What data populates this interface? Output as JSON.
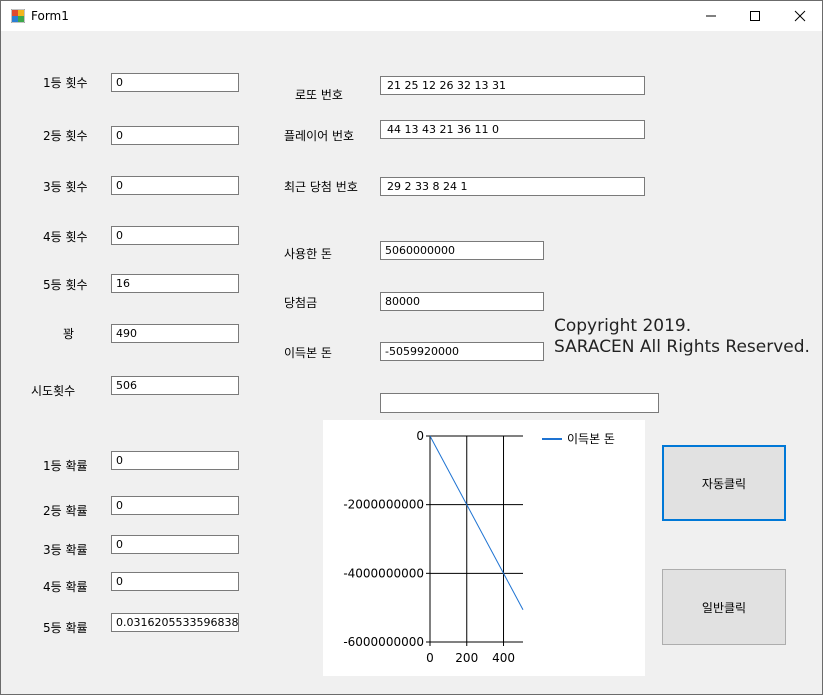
{
  "window": {
    "title": "Form1"
  },
  "left": [
    {
      "label": "1등 횟수",
      "value": "0"
    },
    {
      "label": "2등 횟수",
      "value": "0"
    },
    {
      "label": "3등 횟수",
      "value": "0"
    },
    {
      "label": "4등 횟수",
      "value": "0"
    },
    {
      "label": "5등 횟수",
      "value": "16"
    },
    {
      "label": "꽝",
      "value": "490"
    },
    {
      "label": "시도횟수",
      "value": "506"
    },
    {
      "label": "1등 확률",
      "value": "0"
    },
    {
      "label": "2등 확률",
      "value": "0"
    },
    {
      "label": "3등 확률",
      "value": "0"
    },
    {
      "label": "4등 확률",
      "value": "0"
    },
    {
      "label": "5등 확률",
      "value": "0.0316205533596838"
    }
  ],
  "mid": [
    {
      "label": "로또 번호",
      "value": "21 25 12 26 32 13 31"
    },
    {
      "label": "플레이어 번호",
      "value": "44 13 43 21 36 11 0"
    },
    {
      "label": "최근 당첨 번호",
      "value": "29 2 33 8 24 1"
    },
    {
      "label": "사용한 돈",
      "value": "5060000000"
    },
    {
      "label": "당첨금",
      "value": "80000"
    },
    {
      "label": "이득본 돈",
      "value": "-5059920000"
    }
  ],
  "extra_textbox": {
    "value": ""
  },
  "copyright": {
    "line1": "Copyright 2019.",
    "line2": "SARACEN All Rights Reserved."
  },
  "buttons": {
    "auto": "자동클릭",
    "normal": "일반클릭"
  },
  "chart_data": {
    "type": "line",
    "series": [
      {
        "name": "이득본 돈",
        "x": [
          0,
          506
        ],
        "y": [
          0,
          -5059920000
        ],
        "color": "#1e73d2"
      }
    ],
    "x_ticks": [
      "0",
      "200",
      "400"
    ],
    "x_tick_values": [
      0,
      200,
      400
    ],
    "y_ticks": [
      "0",
      "-2000000000",
      "-4000000000",
      "-6000000000"
    ],
    "y_tick_values": [
      0,
      -2000000000,
      -4000000000,
      -6000000000
    ],
    "xlim": [
      0,
      506
    ],
    "ylim": [
      -6000000000,
      0
    ],
    "grid": true,
    "legend": "top-right"
  }
}
